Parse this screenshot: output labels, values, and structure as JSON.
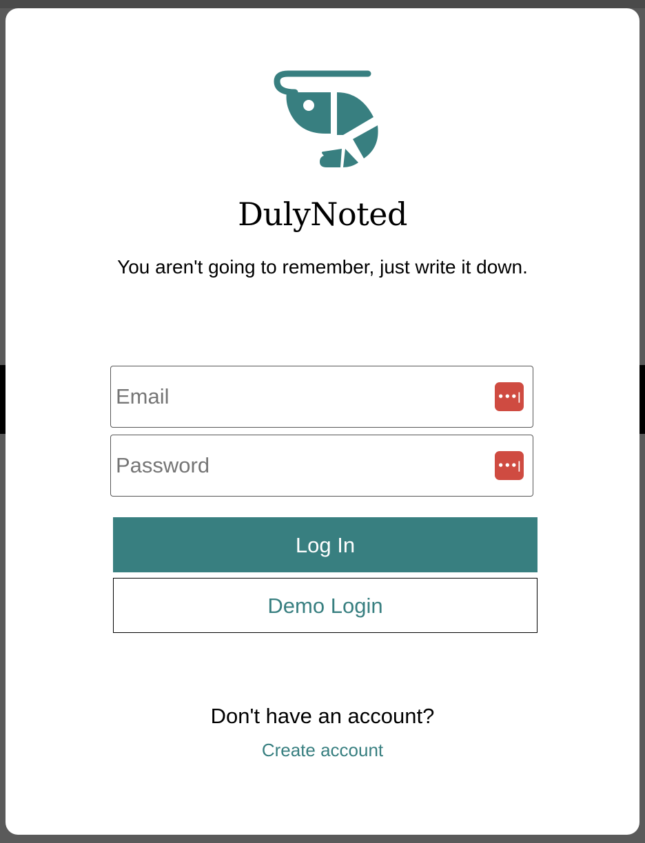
{
  "colors": {
    "brand": "#387f80",
    "password_manager_icon": "#cf4b41",
    "overlay": "#5a5a5a"
  },
  "modal": {
    "logo_icon": "shrimp-logo-icon",
    "app_title": "DulyNoted",
    "tagline": "You aren't going to remember, just write it down.",
    "email": {
      "placeholder": "Email",
      "value": "",
      "autofill_icon": "password-manager-icon"
    },
    "password": {
      "placeholder": "Password",
      "value": "",
      "autofill_icon": "password-manager-icon"
    },
    "login_button": "Log In",
    "demo_button": "Demo Login",
    "no_account_text": "Don't have an account?",
    "create_account_link": "Create account"
  }
}
